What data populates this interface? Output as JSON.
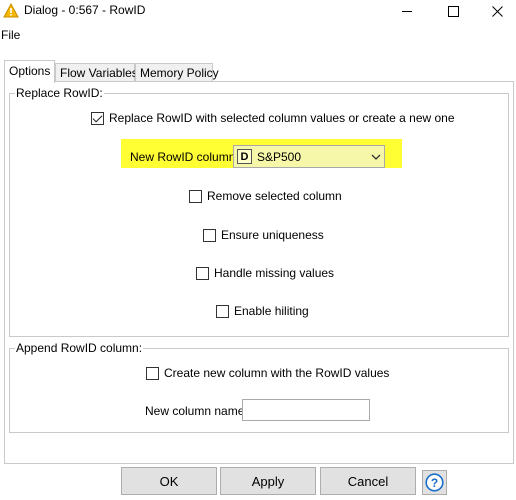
{
  "window": {
    "title": "Dialog - 0:567 - RowID",
    "app_icon": "warning-triangle-icon",
    "controls": [
      "minimize-icon",
      "maximize-icon",
      "close-icon"
    ]
  },
  "menu": {
    "file": "File"
  },
  "tabs": [
    {
      "label": "Options",
      "active": true
    },
    {
      "label": "Flow Variables",
      "active": false
    },
    {
      "label": "Memory Policy",
      "active": false
    }
  ],
  "replace_group": {
    "title": "Replace RowID:",
    "replace_checkbox": {
      "label": "Replace RowID with selected column values or create a new one",
      "checked": true
    },
    "new_rowid": {
      "label": "New RowID column:",
      "type_icon": "D",
      "value": "S&P500",
      "highlight_color": "#ffff33"
    },
    "remove_selected": {
      "label": "Remove selected column",
      "checked": false
    },
    "ensure_uniqueness": {
      "label": "Ensure uniqueness",
      "checked": false
    },
    "handle_missing": {
      "label": "Handle missing values",
      "checked": false
    },
    "enable_hiliting": {
      "label": "Enable hiliting",
      "checked": false
    }
  },
  "append_group": {
    "title": "Append RowID column:",
    "create_new": {
      "label": "Create new column with the RowID values",
      "checked": false
    },
    "name_label": "New column name:",
    "name_value": ""
  },
  "buttons": {
    "ok": "OK",
    "apply": "Apply",
    "cancel": "Cancel",
    "help_icon": "help-icon"
  }
}
